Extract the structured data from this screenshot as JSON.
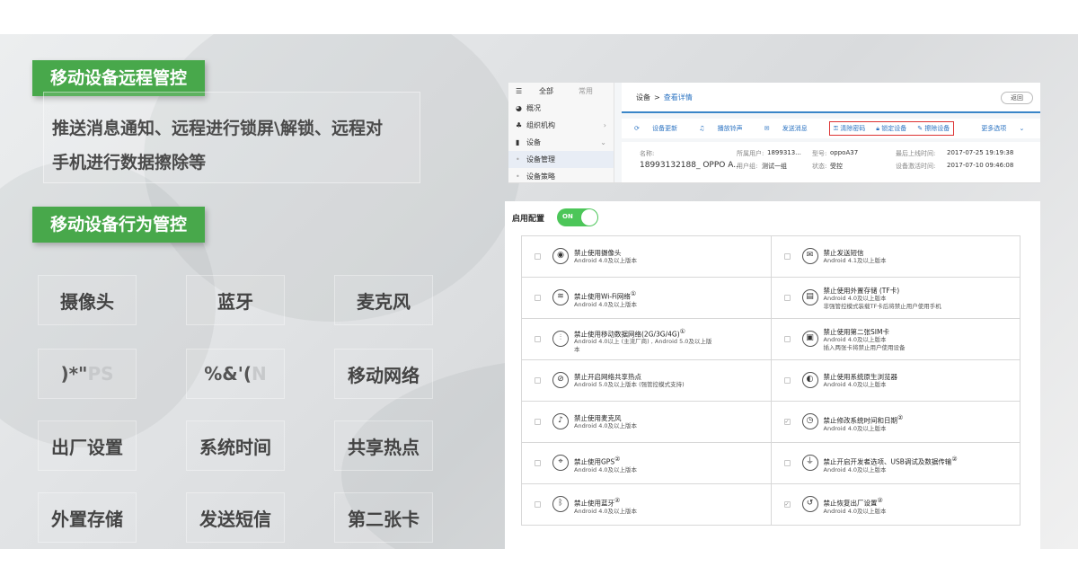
{
  "left": {
    "tag1": "移动设备远程管控",
    "desc_line1": "推送消息通知、远程进行锁屏\\解锁、远程对",
    "desc_line2": "手机进行数据擦除等",
    "tag2": "移动设备行为管控",
    "grid": [
      [
        "摄像头",
        "蓝牙",
        "麦克风"
      ],
      [
        ")*\"",
        "%&'(",
        "移动网络"
      ],
      [
        "出厂设置",
        "系统时间",
        "共享热点"
      ],
      [
        "外置存储",
        "发送短信",
        "第二张卡"
      ]
    ],
    "ghost": {
      "r1c0": "PS",
      "r1c1": "N"
    }
  },
  "admin": {
    "sidebar": {
      "tab_all": "全部",
      "tab_common": "常用",
      "items": [
        "概况",
        "组织机构",
        "设备",
        "设备管理",
        "设备策略"
      ]
    },
    "breadcrumb": {
      "root": "设备",
      "sep": ">",
      "current": "查看详情"
    },
    "back_label": "返回",
    "toolbar": {
      "refresh": "设备更新",
      "ring": "播放铃声",
      "message": "发送消息",
      "clear_pwd": "清除密码",
      "lock": "锁定设备",
      "wipe": "擦除设备",
      "more": "更多选项"
    },
    "info": {
      "name_label": "名称:",
      "name_value": "18993132188_ OPPO A...",
      "owner_label": "所属用户:",
      "owner_value": "1899313...",
      "group_label": "用户组:",
      "group_value": "测试一组",
      "model_label": "型号:",
      "model_value": "oppoA37",
      "status_label": "状态:",
      "status_value": "受控",
      "last_online_label": "最后上线时间:",
      "last_online_value": "2017-07-25 19:19:38",
      "activated_label": "设备激活时间:",
      "activated_value": "2017-07-10 09:46:08"
    }
  },
  "config": {
    "enable_label": "启用配置",
    "toggle_label": "ON",
    "colors": {
      "accent": "#48a84b",
      "toggle": "#4cc659",
      "link": "#2b73c2",
      "highlight": "#d33333"
    },
    "rows": [
      [
        {
          "icon": "camera-icon",
          "title": "禁止使用摄像头",
          "sub": "Android 4.0及以上版本",
          "checked": false
        },
        {
          "icon": "sms-icon",
          "title": "禁止发送短信",
          "sub": "Android 4.1及以上版本",
          "checked": false
        }
      ],
      [
        {
          "icon": "wifi-icon",
          "title": "禁止使用Wi-Fi网络",
          "sup": "①",
          "sub": "Android 4.0及以上版本",
          "checked": false
        },
        {
          "icon": "sdcard-icon",
          "title": "禁止使用外置存储 (TF卡)",
          "sub": "Android 4.0及以上版本",
          "sub2": "非强管控模式装载TF卡后将禁止用户使用手机",
          "checked": false
        }
      ],
      [
        {
          "icon": "mobile-data-icon",
          "title": "禁止使用移动数据网络(2G/3G/4G)",
          "sup": "①",
          "sub": "Android 4.0以上 (主流厂商) , Android 5.0及以上版",
          "sub2": "本",
          "checked": false
        },
        {
          "icon": "sim-icon",
          "title": "禁止使用第二张SIM卡",
          "sub": "Android 4.0及以上版本",
          "sub2": "插入两张卡将禁止用户使用设备",
          "checked": false
        }
      ],
      [
        {
          "icon": "hotspot-icon",
          "title": "禁止开启网络共享热点",
          "sub": "Android 5.0及以上版本 (强管控模式支持)",
          "checked": false
        },
        {
          "icon": "browser-icon",
          "title": "禁止使用系统原生浏览器",
          "sub": "Android 4.0及以上版本",
          "checked": false
        }
      ],
      [
        {
          "icon": "microphone-icon",
          "title": "禁止使用麦克风",
          "sub": "Android 4.0及以上版本",
          "checked": false
        },
        {
          "icon": "clock-icon",
          "title": "禁止修改系统时间和日期",
          "sup": "②",
          "sub": "Android 4.0及以上版本",
          "checked": true
        }
      ],
      [
        {
          "icon": "gps-icon",
          "title": "禁止使用GPS",
          "sup": "②",
          "sub": "Android 4.0及以上版本",
          "checked": false
        },
        {
          "icon": "usb-icon",
          "title": "禁止开启开发者选项、USB调试及数据传输",
          "sup": "②",
          "sub": "Android 4.0及以上版本",
          "checked": false
        }
      ],
      [
        {
          "icon": "bluetooth-icon",
          "title": "禁止使用蓝牙",
          "sup": "②",
          "sub": "Android 4.0及以上版本",
          "checked": false
        },
        {
          "icon": "factory-reset-icon",
          "title": "禁止恢复出厂设置",
          "sup": "②",
          "sub": "Android 4.0及以上版本",
          "checked": true
        }
      ]
    ]
  }
}
